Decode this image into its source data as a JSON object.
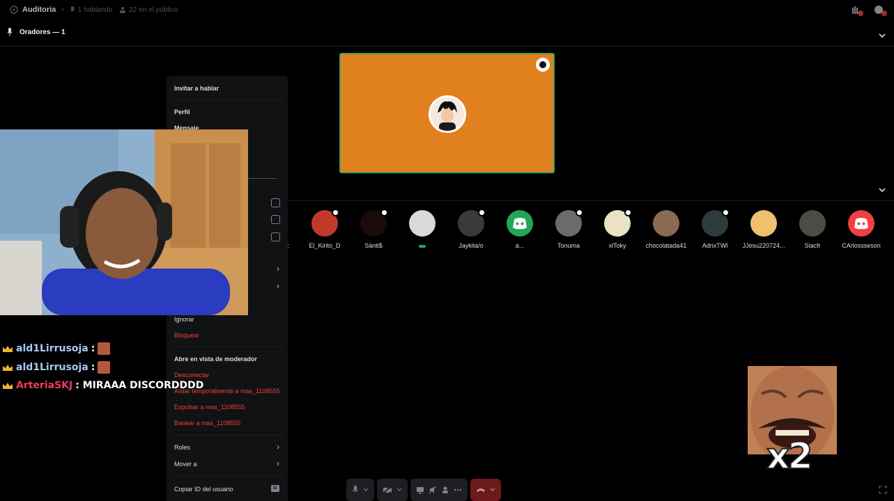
{
  "topbar": {
    "title": "Auditoria",
    "speaking": "1 hablando",
    "audience": "22 en el público"
  },
  "speakers": {
    "header": "Oradores — 1"
  },
  "audience": [
    {
      "name": "El_Kirito_D",
      "color": "#c0392b"
    },
    {
      "name": "Sánti$",
      "color": "#1a0a0a"
    },
    {
      "name": "",
      "color": "#d9d9d9"
    },
    {
      "name": "Jaykita/o",
      "color": "#3a3a3a"
    },
    {
      "name": "a...",
      "color": "#23a559"
    },
    {
      "name": "Tonuma",
      "color": "#6b6b6b"
    },
    {
      "name": "xlToky",
      "color": "#e9e3c3"
    },
    {
      "name": "chocolatada41",
      "color": "#8a6a52"
    },
    {
      "name": "AdrixTWl",
      "color": "#2e3b3a"
    },
    {
      "name": "JJesu220724...",
      "color": "#f0c070"
    },
    {
      "name": "Siacfr",
      "color": "#4a4d44"
    },
    {
      "name": "CArlossseson",
      "color": "#f23f42"
    }
  ],
  "menu": {
    "invite": "Invitar a hablar",
    "profile": "Perfil",
    "message": "Mensaje",
    "ignore": "Ignorar",
    "block": "Bloquear",
    "mod_view": "Abre en vista de moderador",
    "disconnect": "Desconectar",
    "timeout": "Aislar temporalmente a max_1108555",
    "kick": "Expulsar a max_1108555",
    "ban": "Banear a max_1108555",
    "roles": "Roles",
    "move": "Mover a",
    "copy_id": "Copiar ID del usuario",
    "id_badge": "ID"
  },
  "chat": [
    {
      "user": "ald1Lirrusoja",
      "msg": ":",
      "color": "#a9c9f5"
    },
    {
      "user": "ald1Lirrusoja",
      "msg": ":",
      "color": "#a9c9f5"
    },
    {
      "user": "ArteriaSKJ",
      "msg": ": MIRAAA DISCORDDDD",
      "color": "#ec3b5b"
    }
  ],
  "meme": {
    "caption": "x2"
  },
  "colors": {
    "accent_green": "#3ba55d",
    "tile_bg": "#e1801e",
    "danger": "#f23f42",
    "discord_blurple": "#5865f2"
  }
}
